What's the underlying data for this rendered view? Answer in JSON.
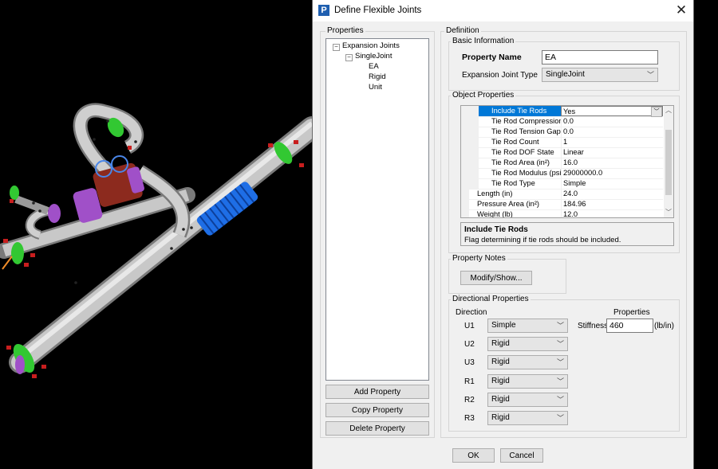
{
  "window": {
    "title": "Define Flexible Joints",
    "app_icon_letter": "P"
  },
  "properties_panel": {
    "label": "Properties",
    "tree": {
      "root": "Expansion Joints",
      "child": "SingleJoint",
      "leaves": [
        "EA",
        "Rigid",
        "Unit"
      ]
    },
    "buttons": {
      "add": "Add Property",
      "copy": "Copy Property",
      "delete": "Delete Property"
    }
  },
  "definition": {
    "label": "Definition",
    "basic_info": {
      "label": "Basic Information",
      "property_name_label": "Property Name",
      "property_name_value": "EA",
      "joint_type_label": "Expansion Joint Type",
      "joint_type_value": "SingleJoint"
    },
    "object_properties": {
      "label": "Object Properties",
      "rows": [
        {
          "name": "Include Tie Rods",
          "value": "Yes"
        },
        {
          "name": "Tie Rod Compression Ga",
          "value": "0.0"
        },
        {
          "name": "Tie Rod Tension Gap (ir",
          "value": "0.0"
        },
        {
          "name": "Tie Rod Count",
          "value": "1"
        },
        {
          "name": "Tie Rod DOF State",
          "value": "Linear"
        },
        {
          "name": "Tie Rod Area (in²)",
          "value": "16.0"
        },
        {
          "name": "Tie Rod Modulus (psi)",
          "value": "29000000.0"
        },
        {
          "name": "Tie Rod Type",
          "value": "Simple"
        },
        {
          "name": "Length (in)",
          "value": "24.0"
        },
        {
          "name": "Pressure Area (in²)",
          "value": "184.96"
        },
        {
          "name": "Weight (lb)",
          "value": "12.0"
        }
      ],
      "description_title": "Include Tie Rods",
      "description_text": "Flag determining if tie rods should be included."
    },
    "property_notes": {
      "label": "Property Notes",
      "button": "Modify/Show..."
    },
    "directional": {
      "label": "Directional Properties",
      "direction_header": "Direction",
      "properties_header": "Properties",
      "rows": [
        {
          "dir": "U1",
          "value": "Simple"
        },
        {
          "dir": "U2",
          "value": "Rigid"
        },
        {
          "dir": "U3",
          "value": "Rigid"
        },
        {
          "dir": "R1",
          "value": "Rigid"
        },
        {
          "dir": "R2",
          "value": "Rigid"
        },
        {
          "dir": "R3",
          "value": "Rigid"
        }
      ],
      "stiffness_label": "Stiffness",
      "stiffness_value": "460",
      "stiffness_unit": "(lb/in)"
    }
  },
  "footer": {
    "ok": "OK",
    "cancel": "Cancel"
  },
  "colors": {
    "accent": "#0078d7",
    "pipe": "#c8c8c8",
    "bellows": "#1e6ee6",
    "flange": "#32c832",
    "purple": "#a050c8",
    "valve": "#8c2a1e"
  }
}
